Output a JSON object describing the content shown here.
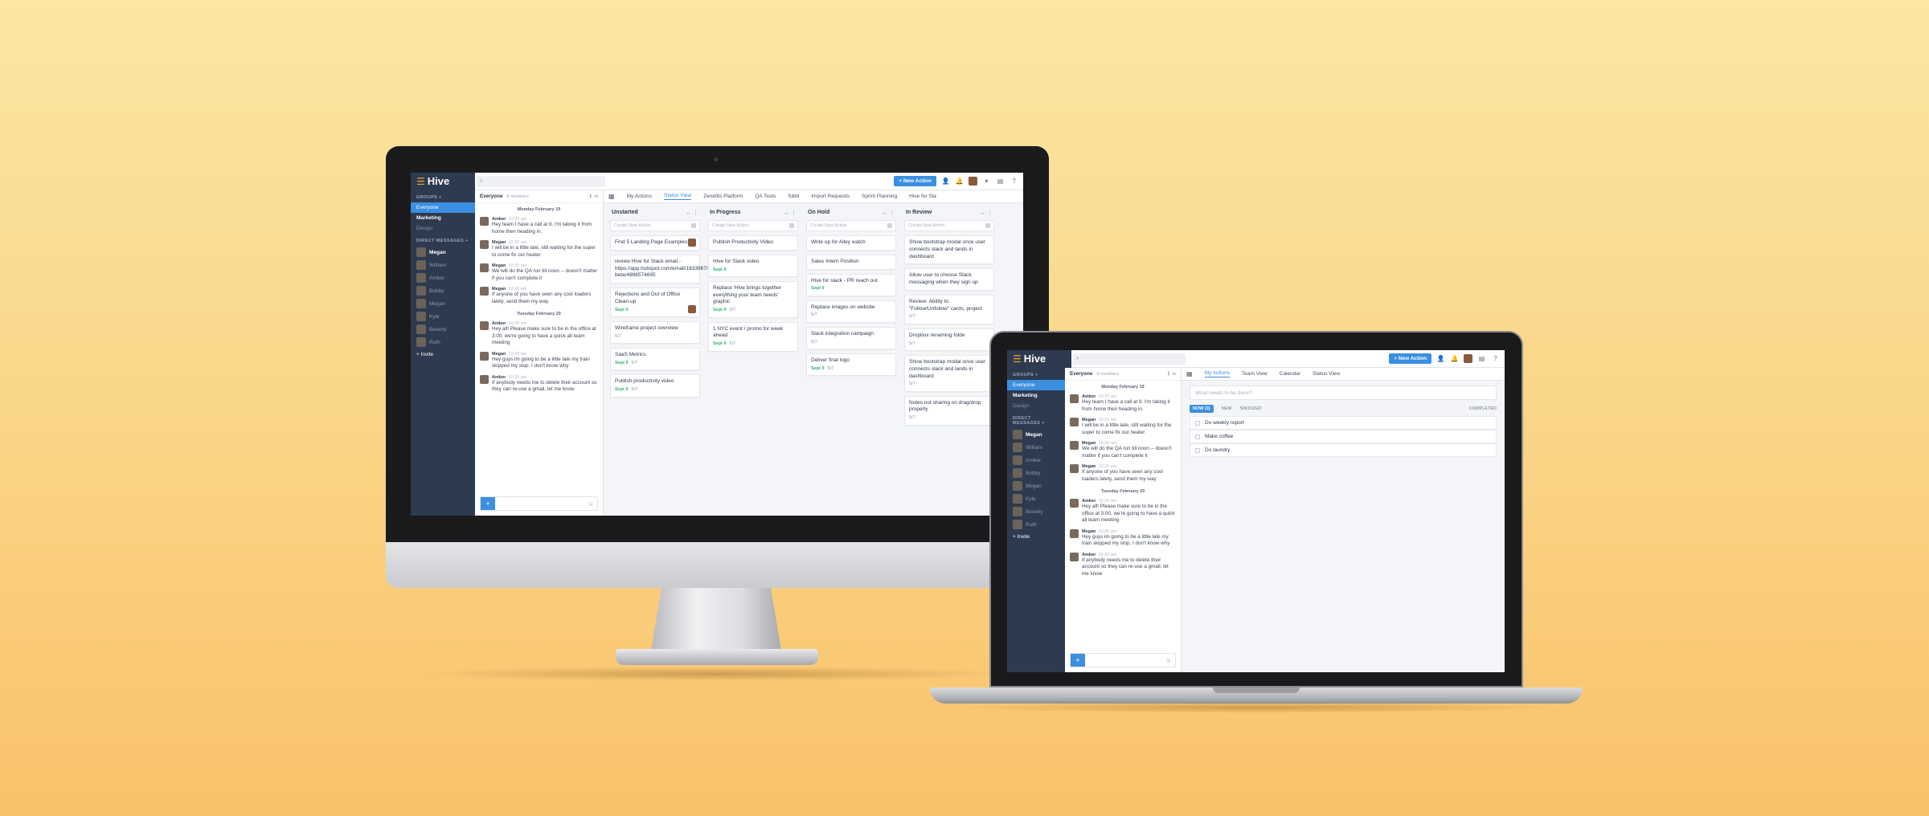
{
  "app": {
    "name": "Hive",
    "new_action": "+ New Action",
    "search_icon": "search-icon"
  },
  "sidebar": {
    "groups_label": "GROUPS +",
    "groups": [
      {
        "label": "Everyone",
        "state": "active"
      },
      {
        "label": "Marketing",
        "state": "bold"
      },
      {
        "label": "Design",
        "state": "dim"
      }
    ],
    "dm_label": "DIRECT MESSAGES +",
    "dms": [
      "Megan",
      "William",
      "Amber",
      "Bobby",
      "Megan",
      "Kyle",
      "Beverly",
      "Ruth"
    ],
    "invite": "+ Invite"
  },
  "chat": {
    "title": "Everyone",
    "members": "8 members",
    "days": [
      {
        "label": "Monday February 19",
        "messages": [
          {
            "author": "Amber",
            "time": "10:20 am",
            "text": "Hey team I have a call at 9. I'm taking it from home then heading in."
          },
          {
            "author": "Megan",
            "time": "10:20 am",
            "text": "I will be in a little late, still waiting for the super to come fix our heater"
          },
          {
            "author": "Megan",
            "time": "10:20 am",
            "text": "We will do the QA run till noon -- doesn't matter if you can't complete it"
          },
          {
            "author": "Megan",
            "time": "10:20 am",
            "text": "If anyone of you have seen any cool loaders lately, send them my way"
          }
        ]
      },
      {
        "label": "Tuesday February 20",
        "messages": [
          {
            "author": "Amber",
            "time": "10:20 am",
            "text": "Hey all! Please make sure to be in the office at 3:00, we're going to have a quick all team meeting"
          },
          {
            "author": "Megan",
            "time": "10:20 am",
            "text": "Hey guys im going to be a little late my train skipped my stop. I don't know why"
          },
          {
            "author": "Amber",
            "time": "10:20 am",
            "text": "If anybody needs me to delete their account so they can re-use a gmail, let me know"
          }
        ]
      }
    ]
  },
  "imac_tabs": [
    "My Actions",
    "Status View",
    "Zenefits Platform",
    "QA Tests",
    "S&M",
    "Import Requests",
    "Sprint Planning",
    "Hive for Sla"
  ],
  "imac_active_tab": "Status View",
  "kanban": {
    "create_placeholder": "Create New Action",
    "columns": [
      {
        "title": "Unstarted",
        "cards": [
          {
            "title": "Find 5 Landing Page Examples",
            "date": "",
            "meta": "",
            "assignee": true
          },
          {
            "title": "review Hive for Slack email - https://app.hubspot.com/email/1833967/edit-beta/4898574695",
            "date": "",
            "meta": "",
            "assignee": false
          },
          {
            "title": "Rejections and Out of Office Clean-up",
            "date": "Sept 9",
            "meta": "",
            "assignee": true
          },
          {
            "title": "Wireframe project overview",
            "date": "",
            "meta": "5/7",
            "assignee": false
          },
          {
            "title": "SaaS Metrics",
            "date": "Sept 9",
            "meta": "5/7",
            "assignee": false
          },
          {
            "title": "Publish productivity video",
            "date": "Sept 9",
            "meta": "5/7",
            "assignee": false
          }
        ]
      },
      {
        "title": "In Progress",
        "cards": [
          {
            "title": "Publish Productivity Video",
            "date": "",
            "meta": "",
            "assignee": false
          },
          {
            "title": "Hive for Slack video",
            "date": "Sept 9",
            "meta": "",
            "assignee": false
          },
          {
            "title": "Replace 'Hive brings together everything your team needs' graphic",
            "date": "Sept 9",
            "meta": "5/7",
            "assignee": false
          },
          {
            "title": "1 NYC event / promo for week ahead",
            "date": "Sept 9",
            "meta": "5/7",
            "assignee": false
          }
        ]
      },
      {
        "title": "On Hold",
        "cards": [
          {
            "title": "Write up for Alley watch",
            "date": "",
            "meta": "",
            "assignee": false
          },
          {
            "title": "Sales Intern Position",
            "date": "",
            "meta": "",
            "assignee": false
          },
          {
            "title": "Hive for slack - PR reach out",
            "date": "Sept 9",
            "meta": "",
            "assignee": false
          },
          {
            "title": "Replace images on website",
            "date": "",
            "meta": "5/7",
            "assignee": false
          },
          {
            "title": "Slack integration campaign",
            "date": "",
            "meta": "5/7",
            "assignee": false
          },
          {
            "title": "Deliver final logo",
            "date": "Sept 9",
            "meta": "5/7",
            "assignee": false
          }
        ]
      },
      {
        "title": "In Review",
        "cards": [
          {
            "title": "Show bootstrap modal once user connects slack and lands in dashboard",
            "date": "",
            "meta": "",
            "assignee": false
          },
          {
            "title": "Allow user to choose Slack messaging when they sign up",
            "date": "",
            "meta": "",
            "assignee": false
          },
          {
            "title": "Review: Ability to \"Follow/Unfollow\" cards, project",
            "date": "",
            "meta": "5/7",
            "assignee": false
          },
          {
            "title": "Dropbox renaming folde",
            "date": "",
            "meta": "5/7",
            "assignee": false
          },
          {
            "title": "Show bootstrap modal once user connects slack and lands in dashboard",
            "date": "",
            "meta": "5/7",
            "assignee": false
          },
          {
            "title": "Notes not sharing on drag/drop properly",
            "date": "",
            "meta": "5/7",
            "assignee": false
          }
        ]
      }
    ]
  },
  "laptop_tabs": [
    "My Actions",
    "Team View",
    "Calendar",
    "Status View"
  ],
  "laptop_active_tab": "My Actions",
  "my_actions": {
    "placeholder": "What needs to be done?",
    "filters": {
      "now": "NOW (3)",
      "new": "NEW",
      "snoozed": "SNOOZED",
      "completed": "COMPLETED"
    },
    "todos": [
      "Do weekly report",
      "Make coffee",
      "Do laundry"
    ]
  },
  "colors": {
    "accent": "#3b8fe0",
    "sidebar": "#2e3a4f",
    "brand": "#f5a623",
    "success": "#2bb673"
  }
}
